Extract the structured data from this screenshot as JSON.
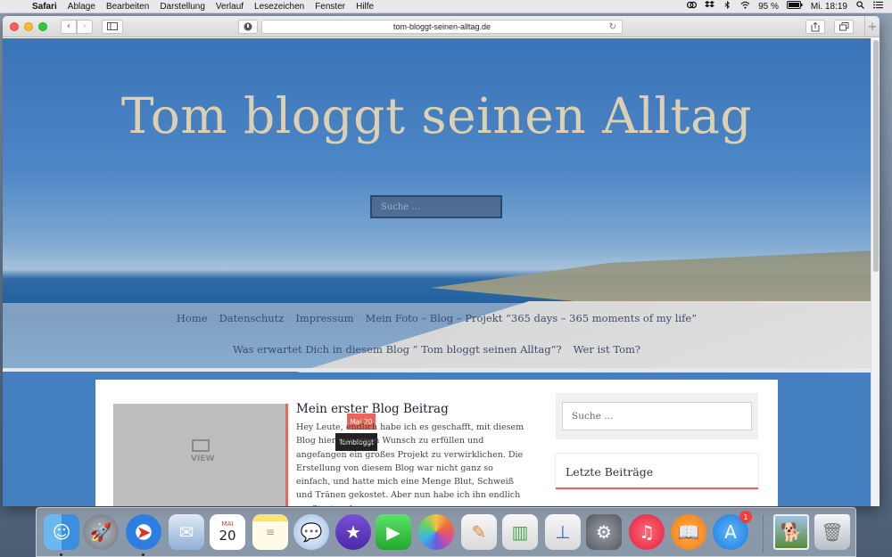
{
  "menubar": {
    "app": "Safari",
    "items": [
      "Ablage",
      "Bearbeiten",
      "Darstellung",
      "Verlauf",
      "Lesezeichen",
      "Fenster",
      "Hilfe"
    ],
    "battery": "95 %",
    "clock": "Mi. 18:19"
  },
  "browser": {
    "url": "tom-bloggt-seinen-alltag.de"
  },
  "site": {
    "title": "Tom bloggt seinen Alltag",
    "hero_search_placeholder": "Suche …",
    "nav_row1": [
      "Home",
      "Datenschutz",
      "Impressum",
      "Mein Foto – Blog – Projekt “365 days – 365 moments of my life”"
    ],
    "nav_row2": [
      "Was erwartet Dich in diesem Blog ” Tom bloggt seinen Alltag”?",
      "Wer ist Tom?"
    ]
  },
  "post": {
    "title": "Mein erster Blog Beitrag",
    "date_badge": "Mai 20",
    "author_badge": "Tombloggt",
    "thumb_label": "VIEW",
    "excerpt": "Hey Leute, endlich habe ich es geschafft, mit diesem Blog hier mir einen Wunsch zu erfüllen und angefangen ein großes Projekt zu verwirklichen. Die Erstellung von diesem Blog war nicht ganz so einfach, und hatte mich eine Menge Blut, Schweiß und Tränen gekostet. Aber nun habe ich ihn endlich am Start und"
  },
  "sidebar": {
    "search_placeholder": "Suche …",
    "recent_title": "Letzte Beiträge"
  },
  "dock": {
    "calendar_month": "MAI",
    "calendar_day": "20",
    "appstore_badge": "1"
  }
}
